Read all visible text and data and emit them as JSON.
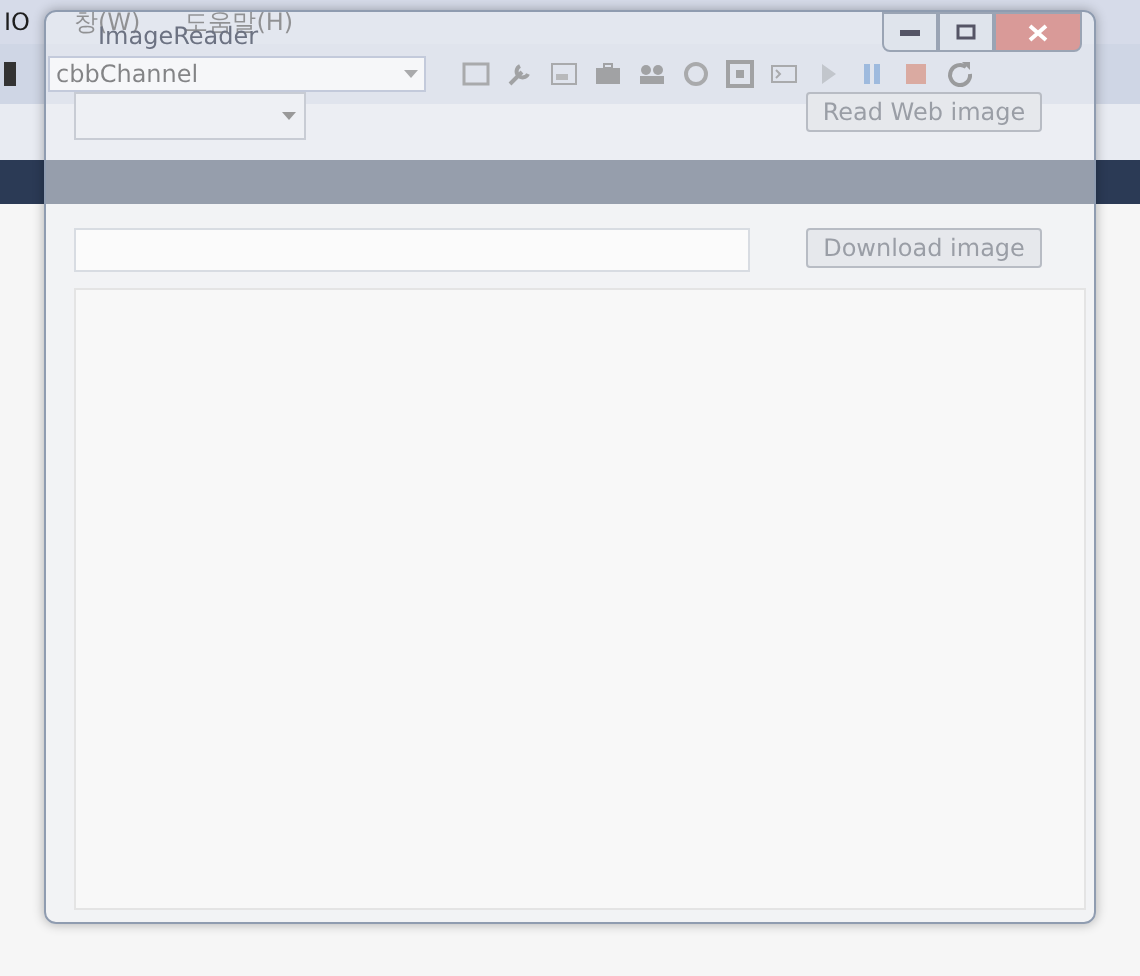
{
  "ide": {
    "menu": [
      {
        "label": "IO"
      },
      {
        "label": "창(W)"
      },
      {
        "label": "도움말(H)"
      }
    ],
    "channel_combo": {
      "value": "cbbChannel"
    }
  },
  "window": {
    "title": "ImageReader",
    "combo": {
      "disabled": true
    },
    "buttons": [
      {
        "label": "Read Web image",
        "disabled": true
      },
      {
        "label": "Download image",
        "disabled": true
      }
    ]
  }
}
